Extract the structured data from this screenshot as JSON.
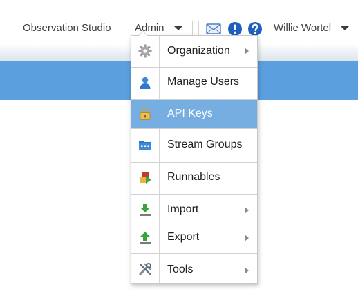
{
  "header": {
    "app_name": "Observation Studio",
    "admin_label": "Admin",
    "user_name": "Willie Wortel",
    "icons": [
      "mail-icon",
      "alert-icon",
      "help-icon"
    ]
  },
  "admin_menu": {
    "items": [
      {
        "label": "Organization",
        "icon": "gear-icon",
        "submenu": true
      },
      {
        "label": "Manage Users",
        "icon": "user-icon",
        "submenu": false
      },
      {
        "label": "API Keys",
        "icon": "lock-icon",
        "submenu": false,
        "selected": true
      },
      {
        "label": "Stream Groups",
        "icon": "folder-icon",
        "submenu": false
      },
      {
        "label": "Runnables",
        "icon": "runnables-icon",
        "submenu": false
      },
      {
        "label": "Import",
        "icon": "import-icon",
        "submenu": true
      },
      {
        "label": "Export",
        "icon": "export-icon",
        "submenu": true
      },
      {
        "label": "Tools",
        "icon": "tools-icon",
        "submenu": true
      }
    ]
  },
  "colors": {
    "accent_bar": "#5b9fde",
    "menu_highlight": "#76aee1"
  }
}
